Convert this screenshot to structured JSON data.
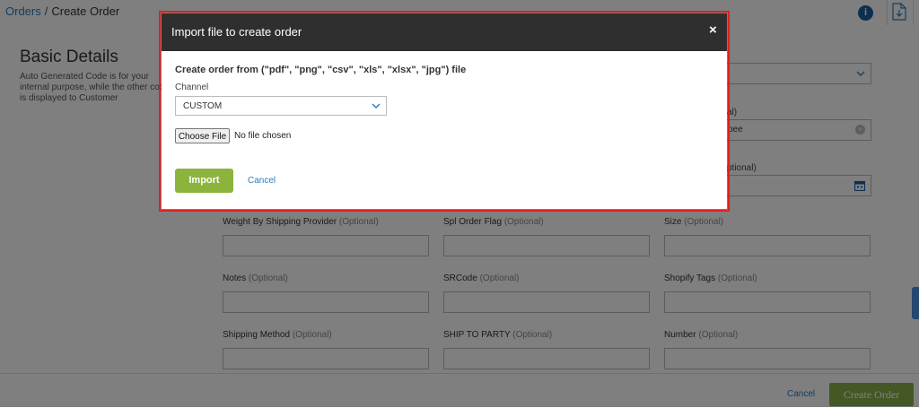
{
  "breadcrumb": {
    "root": "Orders",
    "separator": "/",
    "current": "Create Order"
  },
  "toolbar": {
    "info_icon": "info-icon",
    "doc_icon": "document-icon"
  },
  "basic_details": {
    "title": "Basic Details",
    "description": "Auto Generated Code is for your internal purpose, while the other code is displayed to Customer"
  },
  "form_fields": [
    {
      "label": "Weight By Shipping Provider",
      "optional": "(Optional)"
    },
    {
      "label": "Spl Order Flag",
      "optional": "(Optional)"
    },
    {
      "label": "Size",
      "optional": "(Optional)"
    },
    {
      "label": "Notes",
      "optional": "(Optional)"
    },
    {
      "label": "SRCode",
      "optional": "(Optional)"
    },
    {
      "label": "Shopify Tags",
      "optional": "(Optional)"
    },
    {
      "label": "Shipping Method",
      "optional": "(Optional)"
    },
    {
      "label": "SHIP TO PARTY",
      "optional": "(Optional)"
    },
    {
      "label": "Number",
      "optional": "(Optional)"
    }
  ],
  "partial_fields": {
    "currency_value": "pee",
    "label_fragment_1": "al)",
    "label_fragment_2": "ptional)"
  },
  "footer": {
    "cancel": "Cancel",
    "create": "Create Order"
  },
  "modal": {
    "title": "Import file to create order",
    "close": "×",
    "heading": "Create order from (\"pdf\", \"png\", \"csv\", \"xls\", \"xlsx\", \"jpg\") file",
    "channel_label": "Channel",
    "channel_value": "CUSTOM",
    "choose_file": "Choose File",
    "file_status": "No file chosen",
    "import": "Import",
    "cancel": "Cancel"
  },
  "colors": {
    "accent_green": "#8cb43c",
    "link_blue": "#2a7bc0",
    "header_dark": "#2f2f2f",
    "highlight_red": "#e02020"
  }
}
